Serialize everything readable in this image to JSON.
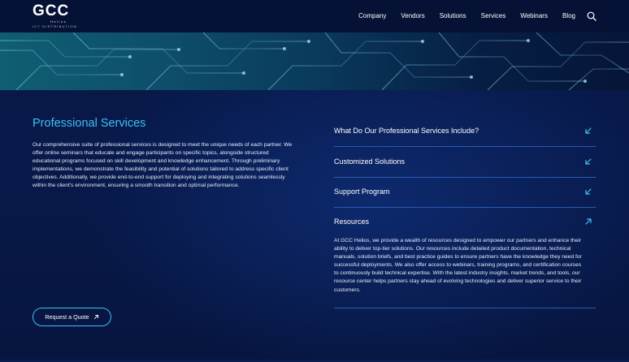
{
  "brand": {
    "name": "GCC",
    "sub": "Helios",
    "tagline": "ICT DISTRIBUTION"
  },
  "nav": {
    "items": [
      {
        "label": "Company"
      },
      {
        "label": "Vendors"
      },
      {
        "label": "Solutions"
      },
      {
        "label": "Services"
      },
      {
        "label": "Webinars"
      },
      {
        "label": "Blog"
      }
    ],
    "search_icon": "search-icon"
  },
  "main": {
    "title": "Professional Services",
    "intro": "Our comprehensive suite of professional services is designed to meet the unique needs of each partner. We offer online seminars that educate and engage participants on specific topics, alongside structured educational programs focused on skill development and knowledge enhancement. Through preliminary implementations, we demonstrate the feasibility and potential of solutions tailored to address specific client objectives. Additionally, we provide end-to-end support for deploying and integrating solutions seamlessly within the client's environment, ensuring a smooth transition and optimal performance.",
    "cta_label": "Request a Quote",
    "cta_icon": "arrow-up-right-icon"
  },
  "accordion": {
    "items": [
      {
        "label": "What Do Our Professional Services Include?",
        "state": "collapsed",
        "icon": "arrow-down-left-icon"
      },
      {
        "label": "Customized Solutions",
        "state": "collapsed",
        "icon": "arrow-down-left-icon"
      },
      {
        "label": "Support Program",
        "state": "collapsed",
        "icon": "arrow-down-left-icon"
      },
      {
        "label": "Resources",
        "state": "expanded",
        "icon": "arrow-up-right-icon",
        "body": "At GCC Helios, we provide a wealth of resources designed to empower our partners and enhance their ability to deliver top-tier solutions. Our resources include detailed product documentation, technical manuals, solution briefs, and best practice guides to ensure partners have the knowledge they need for successful deployments. We also offer access to webinars, training programs, and certification courses to continuously build technical expertise. With the latest industry insights, market trends, and tools, our resource center helps partners stay ahead of evolving technologies and deliver superior service to their customers."
      }
    ]
  },
  "colors": {
    "accent": "#3ec1f3",
    "background": "#061338",
    "divider": "#2a5bb0"
  }
}
